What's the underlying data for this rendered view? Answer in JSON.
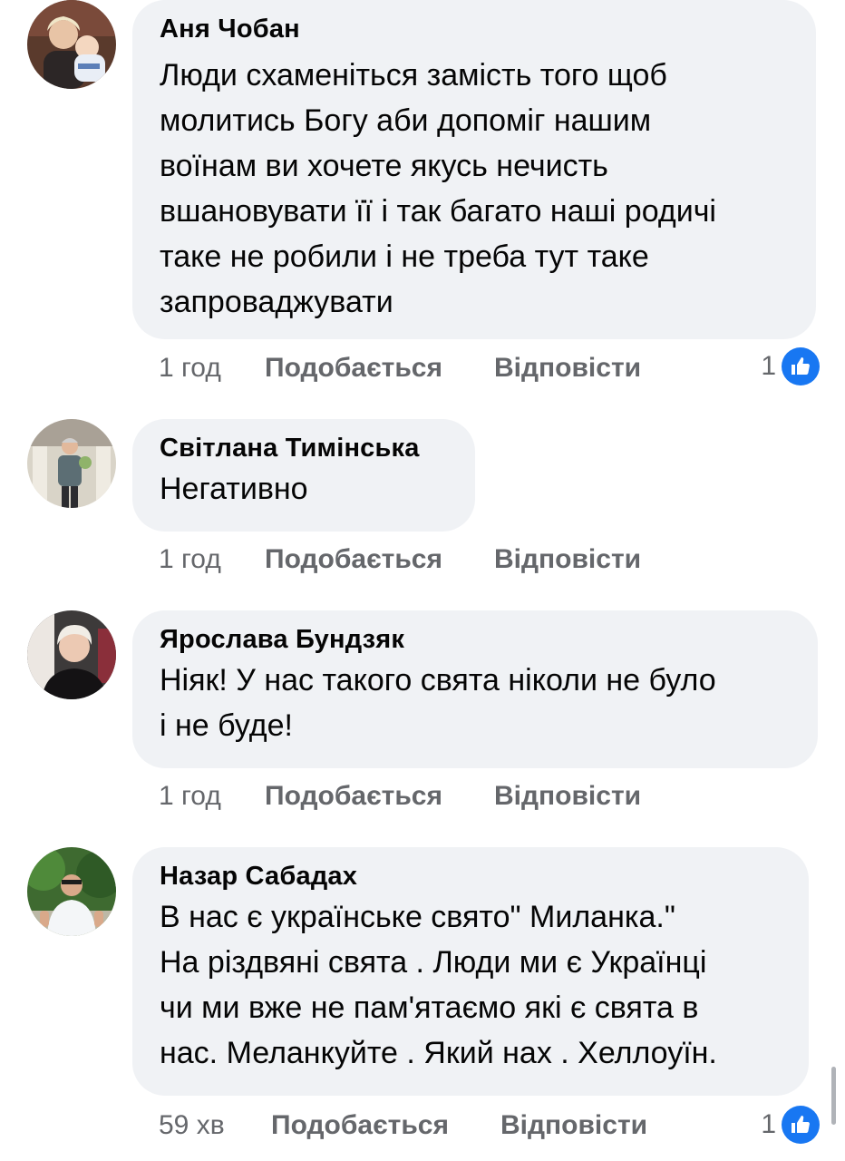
{
  "comments": [
    {
      "author": "Аня Чобан",
      "text": "Люди схаменіться замість того щоб\nмолитись Богу аби допоміг нашим\nвоїнам ви хочете якусь нечисть\nвшановувати її і так багато наші родичі\nтаке не робили і не треба тут таке\nзапроваджувати",
      "time": "1 год",
      "like_label": "Подобається",
      "reply_label": "Відповісти",
      "reaction_count": "1",
      "avatar_icon": "profile-photo"
    },
    {
      "author": "Світлана Тимінська",
      "text": "Негативно",
      "time": "1 год",
      "like_label": "Подобається",
      "reply_label": "Відповісти",
      "avatar_icon": "profile-photo"
    },
    {
      "author": "Ярослава Бундзяк",
      "text": "Ніяк! У нас такого свята ніколи не було\nі не буде!",
      "time": "1 год",
      "like_label": "Подобається",
      "reply_label": "Відповісти",
      "avatar_icon": "profile-photo"
    },
    {
      "author": "Назар Сабадах",
      "text": "В нас є українське свято\" Миланка.\"\nНа різдвяні свята . Люди ми є Українці\nчи ми вже не пам'ятаємо які  є свята в\nнас. Меланкуйте . Який нах . Хеллоуїн.",
      "time": "59 хв",
      "like_label": "Подобається",
      "reply_label": "Відповісти",
      "reaction_count": "1",
      "avatar_icon": "profile-photo"
    }
  ],
  "colors": {
    "bubble": "#f0f2f5",
    "meta_text": "#65676b",
    "like_blue": "#1877f2"
  },
  "reaction_icon": "thumbs-up-icon"
}
